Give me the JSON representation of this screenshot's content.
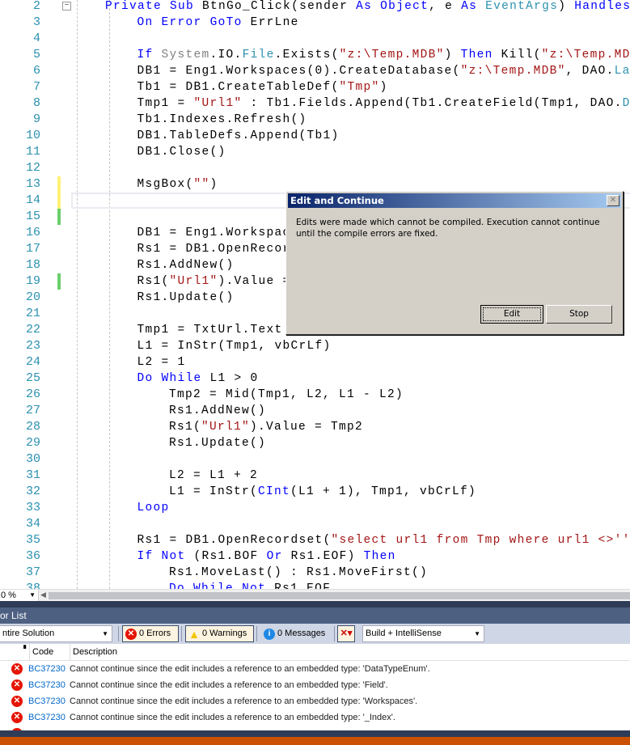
{
  "editor": {
    "lines": [
      {
        "n": "2",
        "indent": 0,
        "segs": [
          [
            "Private",
            "kw"
          ],
          [
            " ",
            ""
          ],
          [
            "Sub",
            "kw"
          ],
          [
            " BtnGo_Click(sender ",
            ""
          ],
          [
            "As",
            "kw"
          ],
          [
            " ",
            ""
          ],
          [
            "Object",
            "kw"
          ],
          [
            ", e ",
            ""
          ],
          [
            "As",
            "kw"
          ],
          [
            " ",
            ""
          ],
          [
            "EventArgs",
            "ty"
          ],
          [
            ") ",
            ""
          ],
          [
            "Handles",
            "kw"
          ]
        ]
      },
      {
        "n": "3",
        "indent": 1,
        "segs": [
          [
            "On",
            "kw"
          ],
          [
            " ",
            ""
          ],
          [
            "Error",
            "kw"
          ],
          [
            " ",
            ""
          ],
          [
            "GoTo",
            "kw"
          ],
          [
            " ErrLne",
            ""
          ]
        ]
      },
      {
        "n": "4",
        "indent": 1,
        "segs": []
      },
      {
        "n": "5",
        "indent": 1,
        "segs": [
          [
            "If",
            "kw"
          ],
          [
            " ",
            ""
          ],
          [
            "System",
            "gr"
          ],
          [
            ".IO.",
            ""
          ],
          [
            "File",
            "ty"
          ],
          [
            ".Exists(",
            ""
          ],
          [
            "\"z:\\Temp.MDB\"",
            "st"
          ],
          [
            ") ",
            ""
          ],
          [
            "Then",
            "kw"
          ],
          [
            " Kill(",
            ""
          ],
          [
            "\"z:\\Temp.MDB",
            "st"
          ]
        ]
      },
      {
        "n": "6",
        "indent": 1,
        "segs": [
          [
            "DB1 = Eng1.Workspaces(0).CreateDatabase(",
            ""
          ],
          [
            "\"z:\\Temp.MDB\"",
            "st"
          ],
          [
            ", DAO.",
            ""
          ],
          [
            "La",
            "ty"
          ]
        ]
      },
      {
        "n": "7",
        "indent": 1,
        "segs": [
          [
            "Tb1 = DB1.CreateTableDef(",
            ""
          ],
          [
            "\"Tmp\"",
            "st"
          ],
          [
            ")",
            ""
          ]
        ]
      },
      {
        "n": "8",
        "indent": 1,
        "segs": [
          [
            "Tmp1 = ",
            ""
          ],
          [
            "\"Url1\"",
            "st"
          ],
          [
            " : Tb1.Fields.Append(Tb1.CreateField(Tmp1, DAO.",
            ""
          ],
          [
            "D",
            "ty"
          ]
        ]
      },
      {
        "n": "9",
        "indent": 1,
        "segs": [
          [
            "Tb1.Indexes.Refresh()",
            ""
          ]
        ]
      },
      {
        "n": "10",
        "indent": 1,
        "segs": [
          [
            "DB1.TableDefs.Append(Tb1)",
            ""
          ]
        ]
      },
      {
        "n": "11",
        "indent": 1,
        "segs": [
          [
            "DB1.Close()",
            ""
          ]
        ]
      },
      {
        "n": "12",
        "indent": 1,
        "segs": []
      },
      {
        "n": "13",
        "indent": 1,
        "segs": [
          [
            "MsgBox(",
            ""
          ],
          [
            "\"\"",
            "st"
          ],
          [
            ")",
            ""
          ]
        ]
      },
      {
        "n": "14",
        "indent": 1,
        "segs": []
      },
      {
        "n": "15",
        "indent": 1,
        "segs": []
      },
      {
        "n": "16",
        "indent": 1,
        "segs": [
          [
            "DB1 = Eng1.Workspac",
            ""
          ]
        ]
      },
      {
        "n": "17",
        "indent": 1,
        "segs": [
          [
            "Rs1 = DB1.OpenRecor",
            ""
          ]
        ]
      },
      {
        "n": "18",
        "indent": 1,
        "segs": [
          [
            "Rs1.AddNew()",
            ""
          ]
        ]
      },
      {
        "n": "19",
        "indent": 1,
        "segs": [
          [
            "Rs1(",
            ""
          ],
          [
            "\"Url1\"",
            "st"
          ],
          [
            ").Value =",
            ""
          ]
        ]
      },
      {
        "n": "20",
        "indent": 1,
        "segs": [
          [
            "Rs1.Update()",
            ""
          ]
        ]
      },
      {
        "n": "21",
        "indent": 1,
        "segs": []
      },
      {
        "n": "22",
        "indent": 1,
        "segs": [
          [
            "Tmp1 = TxtUrl.Text",
            ""
          ]
        ]
      },
      {
        "n": "23",
        "indent": 1,
        "segs": [
          [
            "L1 = InStr(Tmp1, vbCrLf)",
            ""
          ]
        ]
      },
      {
        "n": "24",
        "indent": 1,
        "segs": [
          [
            "L2 = 1",
            ""
          ]
        ]
      },
      {
        "n": "25",
        "indent": 1,
        "segs": [
          [
            "Do",
            "kw"
          ],
          [
            " ",
            ""
          ],
          [
            "While",
            "kw"
          ],
          [
            " L1 > 0",
            ""
          ]
        ]
      },
      {
        "n": "26",
        "indent": 2,
        "segs": [
          [
            "Tmp2 = Mid(Tmp1, L2, L1 - L2)",
            ""
          ]
        ]
      },
      {
        "n": "27",
        "indent": 2,
        "segs": [
          [
            "Rs1.AddNew()",
            ""
          ]
        ]
      },
      {
        "n": "28",
        "indent": 2,
        "segs": [
          [
            "Rs1(",
            ""
          ],
          [
            "\"Url1\"",
            "st"
          ],
          [
            ").Value = Tmp2",
            ""
          ]
        ]
      },
      {
        "n": "29",
        "indent": 2,
        "segs": [
          [
            "Rs1.Update()",
            ""
          ]
        ]
      },
      {
        "n": "30",
        "indent": 2,
        "segs": []
      },
      {
        "n": "31",
        "indent": 2,
        "segs": [
          [
            "L2 = L1 + 2",
            ""
          ]
        ]
      },
      {
        "n": "32",
        "indent": 2,
        "segs": [
          [
            "L1 = InStr(",
            ""
          ],
          [
            "CInt",
            "kw"
          ],
          [
            "(L1 + 1), Tmp1, vbCrLf)",
            ""
          ]
        ]
      },
      {
        "n": "33",
        "indent": 1,
        "segs": [
          [
            "Loop",
            "kw"
          ]
        ]
      },
      {
        "n": "34",
        "indent": 1,
        "segs": []
      },
      {
        "n": "35",
        "indent": 1,
        "segs": [
          [
            "Rs1 = DB1.OpenRecordset(",
            ""
          ],
          [
            "\"select url1 from Tmp where url1 <>''",
            "st"
          ]
        ]
      },
      {
        "n": "36",
        "indent": 1,
        "segs": [
          [
            "If",
            "kw"
          ],
          [
            " ",
            ""
          ],
          [
            "Not",
            "kw"
          ],
          [
            " (Rs1.BOF ",
            ""
          ],
          [
            "Or",
            "kw"
          ],
          [
            " Rs1.EOF) ",
            ""
          ],
          [
            "Then",
            "kw"
          ]
        ]
      },
      {
        "n": "37",
        "indent": 2,
        "segs": [
          [
            "Rs1.MoveLast() : Rs1.MoveFirst()",
            ""
          ]
        ]
      },
      {
        "n": "38",
        "indent": 2,
        "segs": [
          [
            "Do",
            "kw"
          ],
          [
            " ",
            ""
          ],
          [
            "While",
            "kw"
          ],
          [
            " ",
            ""
          ],
          [
            "Not",
            "kw"
          ],
          [
            " Rs1.EOF",
            ""
          ]
        ]
      }
    ],
    "change_marks": [
      {
        "line": "13",
        "color": "#fff176"
      },
      {
        "line": "14",
        "color": "#fff176"
      },
      {
        "line": "15",
        "color": "#6ccf6c"
      },
      {
        "line": "19",
        "color": "#6ccf6c"
      }
    ],
    "zoom_level": "0 %"
  },
  "error_list": {
    "title": "or List",
    "scope": "ntire Solution",
    "errors_label": "0 Errors",
    "warnings_label": "0 Warnings",
    "messages_label": "0 Messages",
    "build_filter": "Build + IntelliSense",
    "columns": {
      "code": "Code",
      "description": "Description"
    },
    "rows": [
      {
        "code": "BC37230",
        "description": "Cannot continue since the edit includes a reference to an embedded type: 'DataTypeEnum'."
      },
      {
        "code": "BC37230",
        "description": "Cannot continue since the edit includes a reference to an embedded type: 'Field'."
      },
      {
        "code": "BC37230",
        "description": "Cannot continue since the edit includes a reference to an embedded type: 'Workspaces'."
      },
      {
        "code": "BC37230",
        "description": "Cannot continue since the edit includes a reference to an embedded type: '_Index'."
      }
    ]
  },
  "dialog": {
    "title": "Edit and Continue",
    "message": "Edits were made which cannot be compiled. Execution cannot continue until the compile errors are fixed.",
    "edit_label": "Edit",
    "stop_label": "Stop"
  },
  "colors": {
    "keyword": "#0000ff",
    "type": "#2b91af",
    "string": "#a31515",
    "status_bar": "#ca5100",
    "panel_title": "#4d6082",
    "error": "#e51400"
  }
}
